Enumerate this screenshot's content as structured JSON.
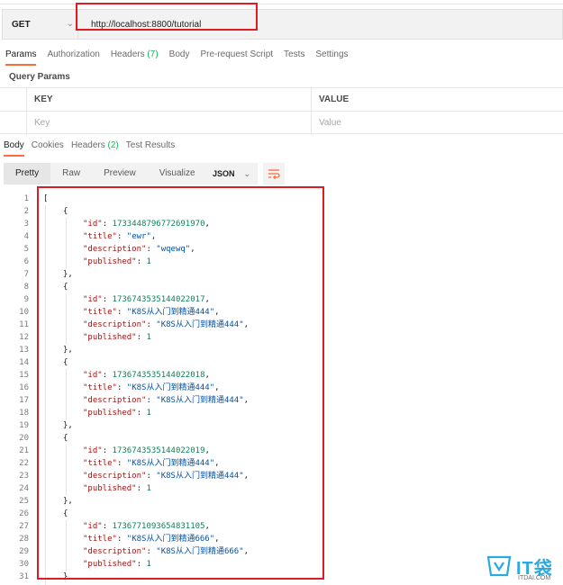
{
  "request": {
    "method": "GET",
    "url": "http://localhost:8800/tutorial"
  },
  "request_tabs": [
    {
      "label": "Params",
      "active": true
    },
    {
      "label": "Authorization"
    },
    {
      "label": "Headers",
      "count": "(7)"
    },
    {
      "label": "Body"
    },
    {
      "label": "Pre-request Script"
    },
    {
      "label": "Tests"
    },
    {
      "label": "Settings"
    }
  ],
  "query_params": {
    "title": "Query Params",
    "col_key": "KEY",
    "col_value": "VALUE",
    "key_placeholder": "Key",
    "value_placeholder": "Value"
  },
  "response_tabs": [
    {
      "label": "Body",
      "active": true
    },
    {
      "label": "Cookies"
    },
    {
      "label": "Headers",
      "count": "(2)"
    },
    {
      "label": "Test Results"
    }
  ],
  "view_modes": [
    {
      "label": "Pretty",
      "active": true
    },
    {
      "label": "Raw"
    },
    {
      "label": "Preview"
    },
    {
      "label": "Visualize"
    }
  ],
  "format": "JSON",
  "records": [
    {
      "id": "1733448796772691970",
      "title": "\"ewr\"",
      "description": "\"wqewq\"",
      "published": "1"
    },
    {
      "id": "1736743535144022017",
      "title": "\"K8S从入门到精通444\"",
      "description": "\"K8S从入门到精通444\"",
      "published": "1"
    },
    {
      "id": "1736743535144022018",
      "title": "\"K8S从入门到精通444\"",
      "description": "\"K8S从入门到精通444\"",
      "published": "1"
    },
    {
      "id": "1736743535144022019",
      "title": "\"K8S从入门到精通444\"",
      "description": "\"K8S从入门到精通444\"",
      "published": "1"
    },
    {
      "id": "1736771093654831105",
      "title": "\"K8S从入门到精通666\"",
      "description": "\"K8S从入门到精通666\"",
      "published": "1"
    }
  ],
  "watermark": {
    "name": "IT袋",
    "sub": "ITDAI.COM"
  }
}
